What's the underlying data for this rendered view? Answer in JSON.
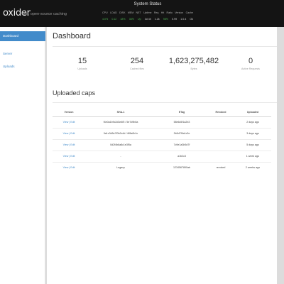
{
  "header": {
    "logo": "oxider",
    "tagline": "fast, open-source caching",
    "status_title": "System Status",
    "status_labels": [
      "CPU",
      "LOAD",
      "DISK",
      "MEM",
      "NET",
      "Uptime",
      "Req",
      "Hit",
      "Ratio",
      "Version",
      "Cache"
    ],
    "status_values": [
      "4.0%",
      "0.12",
      "18%",
      "36%",
      "Up",
      "3d 4h",
      "1.2k",
      "98%",
      "0.99",
      "1.0.4",
      "Ok"
    ]
  },
  "sidebar": {
    "items": [
      {
        "label": "Dashboard"
      },
      {
        "label": "Server"
      },
      {
        "label": "Uploads"
      }
    ]
  },
  "main": {
    "title": "Dashboard",
    "stats": [
      {
        "value": "15",
        "label": "Uploads"
      },
      {
        "value": "254",
        "label": "Cached files"
      },
      {
        "value": "1,623,275,482",
        "label": "Bytes"
      },
      {
        "value": "0",
        "label": "Active Requests"
      }
    ],
    "table_title": "Uploaded caps",
    "table": {
      "headers": [
        "Version",
        "SHA-1",
        "ETag",
        "Revoked",
        "Uploaded"
      ],
      "rows": [
        [
          "View | Edit",
          "f4e0a1b9c2d3e4f5 / 5e7d9b0a",
          "58e6c5f1a2b3",
          "",
          "2 days ago"
        ],
        [
          "View | Edit",
          "9a1c3d5e7f0b2c4d / 6f8a0b1c",
          "3b5d7f9a1c2e",
          "",
          "3 days ago"
        ],
        [
          "View | Edit",
          "0d2f4b6a8c1e3f5a",
          "7c9e1a3b5d7f",
          "",
          "5 days ago"
        ],
        [
          "View | Edit",
          "-",
          "a1b2c3",
          "",
          "1 week ago"
        ],
        [
          "View | Edit",
          "Legacy",
          "1234567890ab",
          "revoked",
          "2 weeks ago"
        ]
      ]
    }
  }
}
